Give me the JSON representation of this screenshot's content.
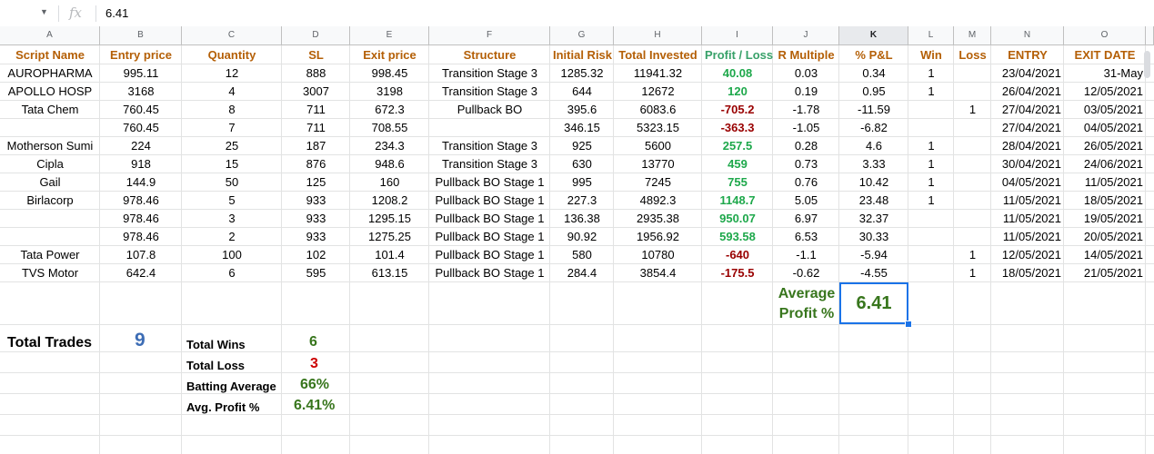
{
  "formula_bar": {
    "value": "6.41",
    "fx_label": "fx"
  },
  "columns": [
    "A",
    "B",
    "C",
    "D",
    "E",
    "F",
    "G",
    "H",
    "I",
    "J",
    "K",
    "L",
    "M",
    "N",
    "O"
  ],
  "headers": {
    "script_name": "Script Name",
    "entry_price": "Entry price",
    "quantity": "Quantity",
    "sl": "SL",
    "exit_price": "Exit price",
    "structure": "Structure",
    "initial_risk": "Initial Risk",
    "total_invested": "Total Invested",
    "profit_loss": "Profit / Loss",
    "r_multiple": "R Multiple",
    "pnl_pct": "% P&L",
    "win": "Win",
    "loss": "Loss",
    "entry": "ENTRY",
    "exit_date": "EXIT DATE"
  },
  "rows": [
    {
      "name": "AUROPHARMA",
      "entry": "995.11",
      "qty": "12",
      "sl": "888",
      "exit": "998.45",
      "structure": "Transition Stage 3",
      "risk": "1285.32",
      "invested": "11941.32",
      "pl": "40.08",
      "pl_sign": "pos",
      "r": "0.03",
      "pct": "0.34",
      "win": "1",
      "loss": "",
      "entry_date": "23/04/2021",
      "exit_date": "31-May"
    },
    {
      "name": "APOLLO HOSP",
      "entry": "3168",
      "qty": "4",
      "sl": "3007",
      "exit": "3198",
      "structure": "Transition Stage 3",
      "risk": "644",
      "invested": "12672",
      "pl": "120",
      "pl_sign": "pos",
      "r": "0.19",
      "pct": "0.95",
      "win": "1",
      "loss": "",
      "entry_date": "26/04/2021",
      "exit_date": "12/05/2021"
    },
    {
      "name": "Tata Chem",
      "entry": "760.45",
      "qty": "8",
      "sl": "711",
      "exit": "672.3",
      "structure": "Pullback BO",
      "risk": "395.6",
      "invested": "6083.6",
      "pl": "-705.2",
      "pl_sign": "neg",
      "r": "-1.78",
      "pct": "-11.59",
      "win": "",
      "loss": "1",
      "entry_date": "27/04/2021",
      "exit_date": "03/05/2021"
    },
    {
      "name": "",
      "entry": "760.45",
      "qty": "7",
      "sl": "711",
      "exit": "708.55",
      "structure": "",
      "risk": "346.15",
      "invested": "5323.15",
      "pl": "-363.3",
      "pl_sign": "neg",
      "r": "-1.05",
      "pct": "-6.82",
      "win": "",
      "loss": "",
      "entry_date": "27/04/2021",
      "exit_date": "04/05/2021"
    },
    {
      "name": "Motherson Sumi",
      "entry": "224",
      "qty": "25",
      "sl": "187",
      "exit": "234.3",
      "structure": "Transition Stage 3",
      "risk": "925",
      "invested": "5600",
      "pl": "257.5",
      "pl_sign": "pos",
      "r": "0.28",
      "pct": "4.6",
      "win": "1",
      "loss": "",
      "entry_date": "28/04/2021",
      "exit_date": "26/05/2021"
    },
    {
      "name": "Cipla",
      "entry": "918",
      "qty": "15",
      "sl": "876",
      "exit": "948.6",
      "structure": "Transition Stage 3",
      "risk": "630",
      "invested": "13770",
      "pl": "459",
      "pl_sign": "pos",
      "r": "0.73",
      "pct": "3.33",
      "win": "1",
      "loss": "",
      "entry_date": "30/04/2021",
      "exit_date": "24/06/2021"
    },
    {
      "name": "Gail",
      "entry": "144.9",
      "qty": "50",
      "sl": "125",
      "exit": "160",
      "structure": "Pullback BO Stage 1",
      "risk": "995",
      "invested": "7245",
      "pl": "755",
      "pl_sign": "pos",
      "r": "0.76",
      "pct": "10.42",
      "win": "1",
      "loss": "",
      "entry_date": "04/05/2021",
      "exit_date": "11/05/2021"
    },
    {
      "name": "Birlacorp",
      "entry": "978.46",
      "qty": "5",
      "sl": "933",
      "exit": "1208.2",
      "structure": "Pullback BO Stage 1",
      "risk": "227.3",
      "invested": "4892.3",
      "pl": "1148.7",
      "pl_sign": "pos",
      "r": "5.05",
      "pct": "23.48",
      "win": "1",
      "loss": "",
      "entry_date": "11/05/2021",
      "exit_date": "18/05/2021"
    },
    {
      "name": "",
      "entry": "978.46",
      "qty": "3",
      "sl": "933",
      "exit": "1295.15",
      "structure": "Pullback BO Stage 1",
      "risk": "136.38",
      "invested": "2935.38",
      "pl": "950.07",
      "pl_sign": "pos",
      "r": "6.97",
      "pct": "32.37",
      "win": "",
      "loss": "",
      "entry_date": "11/05/2021",
      "exit_date": "19/05/2021"
    },
    {
      "name": "",
      "entry": "978.46",
      "qty": "2",
      "sl": "933",
      "exit": "1275.25",
      "structure": "Pullback BO Stage 1",
      "risk": "90.92",
      "invested": "1956.92",
      "pl": "593.58",
      "pl_sign": "pos",
      "r": "6.53",
      "pct": "30.33",
      "win": "",
      "loss": "",
      "entry_date": "11/05/2021",
      "exit_date": "20/05/2021"
    },
    {
      "name": "Tata Power",
      "entry": "107.8",
      "qty": "100",
      "sl": "102",
      "exit": "101.4",
      "structure": "Pullback BO Stage 1",
      "risk": "580",
      "invested": "10780",
      "pl": "-640",
      "pl_sign": "neg",
      "r": "-1.1",
      "pct": "-5.94",
      "win": "",
      "loss": "1",
      "entry_date": "12/05/2021",
      "exit_date": "14/05/2021"
    },
    {
      "name": "TVS Motor",
      "entry": "642.4",
      "qty": "6",
      "sl": "595",
      "exit": "613.15",
      "structure": "Pullback BO Stage 1",
      "risk": "284.4",
      "invested": "3854.4",
      "pl": "-175.5",
      "pl_sign": "neg",
      "r": "-0.62",
      "pct": "-4.55",
      "win": "",
      "loss": "1",
      "entry_date": "18/05/2021",
      "exit_date": "21/05/2021"
    }
  ],
  "average": {
    "label_line1": "Average",
    "label_line2": "Profit %",
    "value": "6.41"
  },
  "summary": {
    "total_trades_label": "Total Trades",
    "total_trades_value": "9",
    "total_wins_label": "Total Wins",
    "total_wins_value": "6",
    "total_loss_label": "Total Loss",
    "total_loss_value": "3",
    "batting_avg_label": "Batting Average",
    "batting_avg_value": "66%",
    "avg_profit_label": "Avg. Profit %",
    "avg_profit_value": "6.41%"
  },
  "colors": {
    "header": "#b45f06",
    "profit_header": "#38a169",
    "positive": "#1ea84b",
    "negative": "#990000",
    "summary_green": "#38761d",
    "summary_red": "#cc0000",
    "summary_blue": "#3d6db5"
  }
}
